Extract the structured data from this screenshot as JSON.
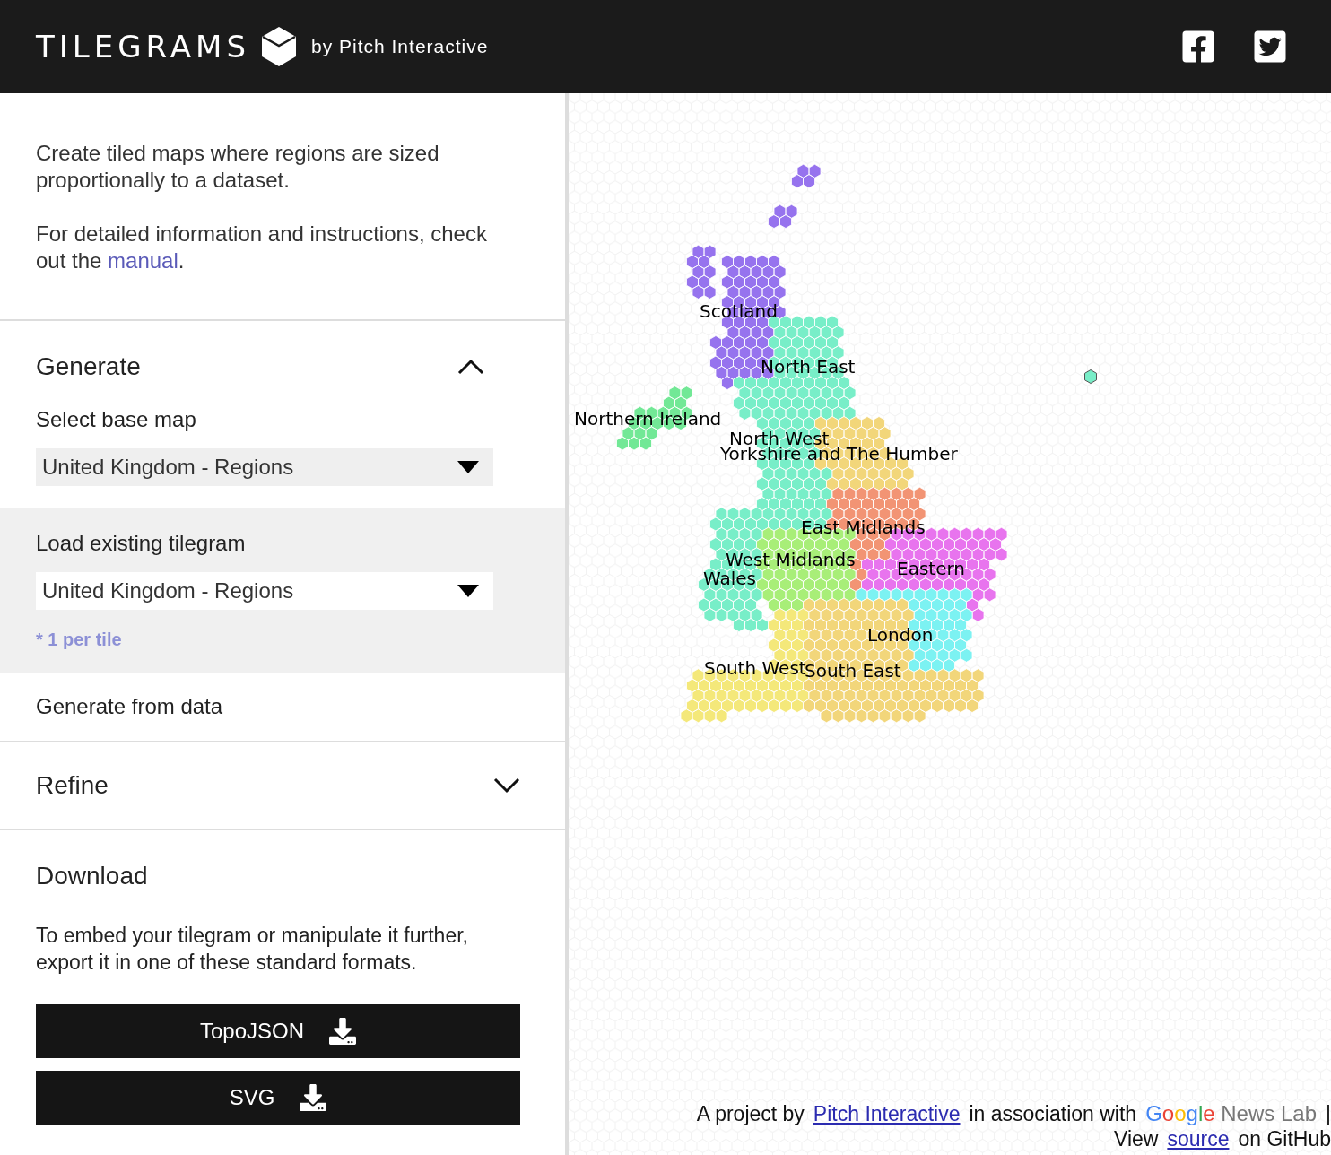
{
  "header": {
    "title": "TILEGRAMS",
    "byline": "by Pitch Interactive"
  },
  "intro": {
    "text": "Create tiled maps where regions are sized proportionally to a dataset.",
    "manual_before": "For detailed information and instructions, check out the",
    "manual_link": "manual",
    "manual_after": "."
  },
  "sections": [
    {
      "kind": "generate",
      "title": "Generate",
      "expanded": true,
      "base_label": "Select base map",
      "base_value": "United Kingdom - Regions",
      "options": [
        {
          "kind": "load",
          "label": "Load existing tilegram",
          "selected": true,
          "value": "United Kingdom - Regions",
          "note": "* 1 per tile"
        },
        {
          "kind": "data",
          "label": "Generate from data",
          "selected": false
        }
      ]
    },
    {
      "kind": "refine",
      "title": "Refine",
      "expanded": false
    },
    {
      "kind": "download",
      "title": "Download",
      "text": "To embed your tilegram or manipulate it further, export it in one of these standard formats.",
      "buttons": [
        "TopoJSON",
        "SVG"
      ]
    }
  ],
  "regions": [
    {
      "name": "Scotland",
      "color": "#9673ee"
    },
    {
      "name": "North East",
      "color": "#78eec8"
    },
    {
      "name": "Northern Ireland",
      "color": "#72e896"
    },
    {
      "name": "North West",
      "color": "#78eec8"
    },
    {
      "name": "Yorkshire and The Humber",
      "color": "#f2d67a"
    },
    {
      "name": "East Midlands",
      "color": "#f29474"
    },
    {
      "name": "West Midlands",
      "color": "#a8ee78"
    },
    {
      "name": "Wales",
      "color": "#78eec8"
    },
    {
      "name": "Eastern",
      "color": "#e874ee"
    },
    {
      "name": "London",
      "color": "#7cf2f2"
    },
    {
      "name": "South West",
      "color": "#f4e87a"
    },
    {
      "name": "South East",
      "color": "#f2d67a"
    }
  ],
  "footer": {
    "line1_before": "A project by",
    "line1_link": "Pitch Interactive",
    "line1_after": "in association with",
    "partner_google": "Google",
    "partner_rest": "News Lab",
    "separator": "|",
    "line2_before": "View",
    "line2_link": "source",
    "line2_after": "on GitHub"
  }
}
